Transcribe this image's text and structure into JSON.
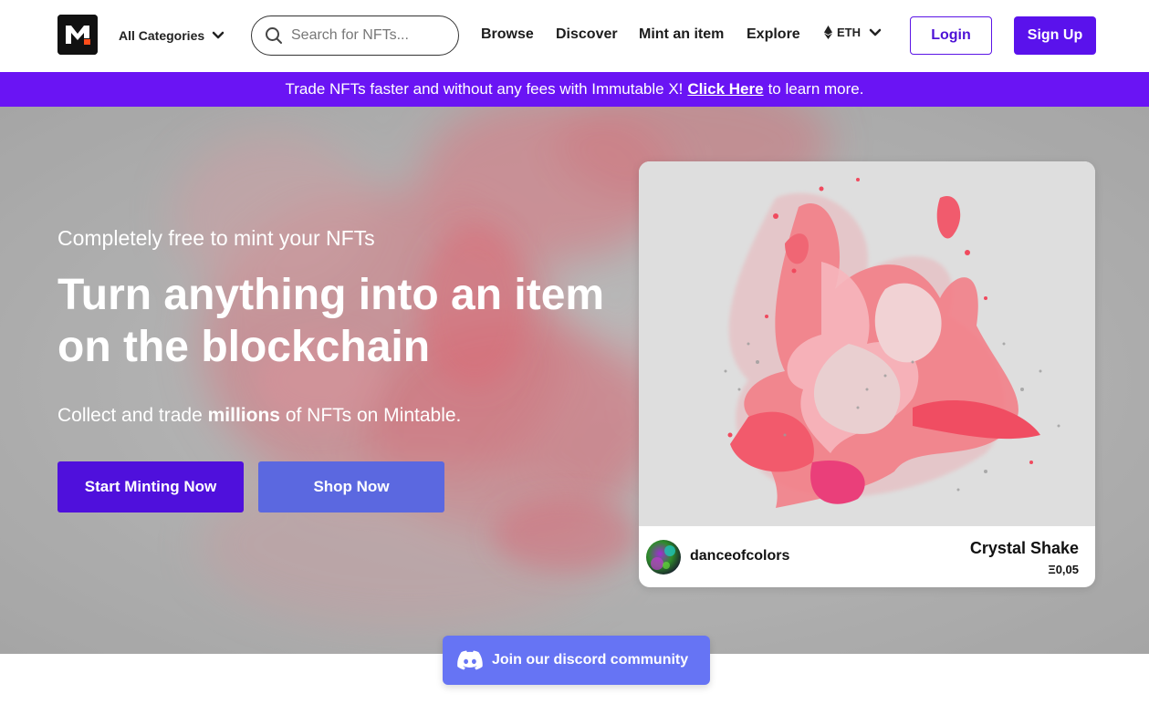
{
  "header": {
    "logo_letter": "M",
    "category_select": {
      "label": "All Categories",
      "icon": "chevron-down-icon"
    },
    "search": {
      "placeholder": "Search for NFTs...",
      "value": "",
      "icon": "search-icon"
    },
    "nav": [
      {
        "label": "Browse"
      },
      {
        "label": "Discover"
      },
      {
        "label": "Mint an item"
      },
      {
        "label": "Explore"
      }
    ],
    "currency": {
      "label": "ETH",
      "icon": "ethereum-icon"
    },
    "login_label": "Login",
    "signup_label": "Sign Up"
  },
  "banner": {
    "text_before": "Trade NFTs faster and without any fees with Immutable X!",
    "link_label": "Click Here",
    "text_after": "to learn more."
  },
  "hero": {
    "subtitle": "Completely free to mint your NFTs",
    "title": "Turn anything into an item on the blockchain",
    "desc_before": "Collect and trade",
    "desc_bold": "millions",
    "desc_after": "of NFTs on Mintable.",
    "primary_button": "Start Minting Now",
    "secondary_button": "Shop Now"
  },
  "featured_card": {
    "creator": "danceofcolors",
    "name": "Crystal Shake",
    "price": "Ξ0,05"
  },
  "discord": {
    "label": "Join our discord community",
    "icon": "discord-icon"
  },
  "colors": {
    "brand_purple": "#5a12ec",
    "banner_purple": "#6a14f4",
    "shop_blue": "#5b68e0",
    "discord_blue": "#6674f4"
  }
}
